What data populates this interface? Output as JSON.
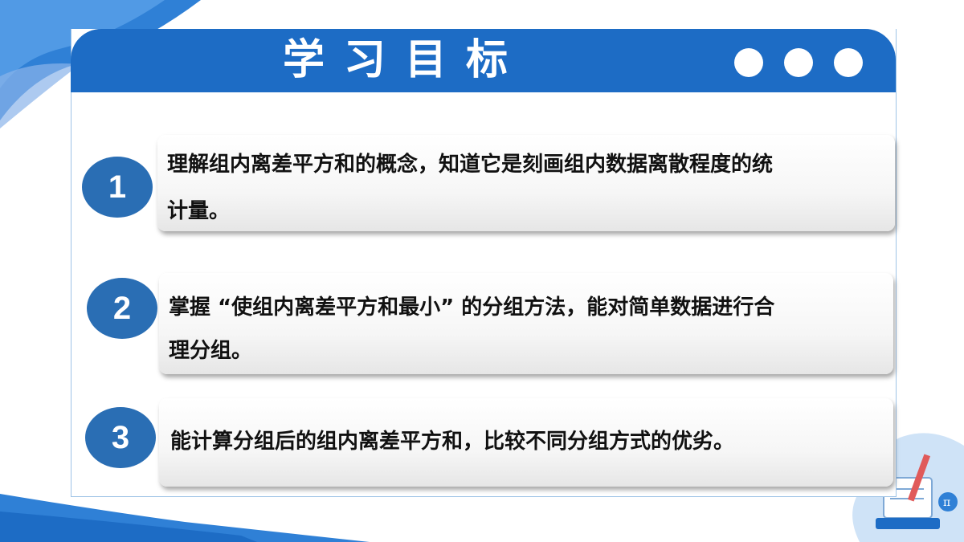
{
  "title": "学习目标",
  "colors": {
    "header": "#1d6cc5",
    "circle": "#2a6eb4",
    "border": "#9ec3e6"
  },
  "header_dots": [
    "dot",
    "dot",
    "dot"
  ],
  "goals": [
    {
      "number": "1",
      "lines": [
        "理解组内离差平方和的概念，知道它是刻画组内数据离散程度的统",
        "计量。"
      ]
    },
    {
      "number": "2",
      "lines": [
        "掌握 “使组内离差平方和最小” 的分组方法，能对简单数据进行合",
        "理分组。"
      ]
    },
    {
      "number": "3",
      "lines": [
        "能计算分组后的组内离差平方和，比较不同分组方式的优劣。"
      ]
    }
  ],
  "decorations": [
    "wave-top-left",
    "wave-bottom-left",
    "math-illustration"
  ],
  "illustration_glyph": "π"
}
